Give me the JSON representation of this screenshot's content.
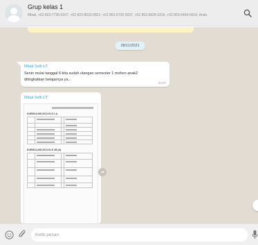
{
  "header": {
    "title": "Grup kelas 1",
    "members": "Mbak, +62 823-7735-0107, +62 823-8633-5821, +62 852-6730-3037, +62 853-6628-3316, +62 853-6464-6619, Anda",
    "icons": [
      "avatar-icon",
      "search-icon"
    ]
  },
  "chat": {
    "date_separator": "28/11/2021",
    "messages": [
      {
        "sender": "Mbak Selli UT",
        "text": "Senin mulai tanggal 6 kita sudah ulangan semester 1 mohon anak2 ditingkatkan belajarnya ya...",
        "time": "23.07"
      },
      {
        "sender": "Mbak Selli UT",
        "document": {
          "section_1": "KURIKULUM 2013 KLS 1 A",
          "section_2": "KURIKULUM 2013 KLS 1B (A)"
        }
      }
    ]
  },
  "footer": {
    "placeholder": "Ketik pesan",
    "icons": [
      "emoji-icon",
      "paperclip-icon",
      "microphone-icon"
    ]
  },
  "colors": {
    "header_bg": "#ededed",
    "chat_bg": "#e2dcd3",
    "sender_name": "#35a7d3",
    "date_pill": "#e1f2fb"
  }
}
